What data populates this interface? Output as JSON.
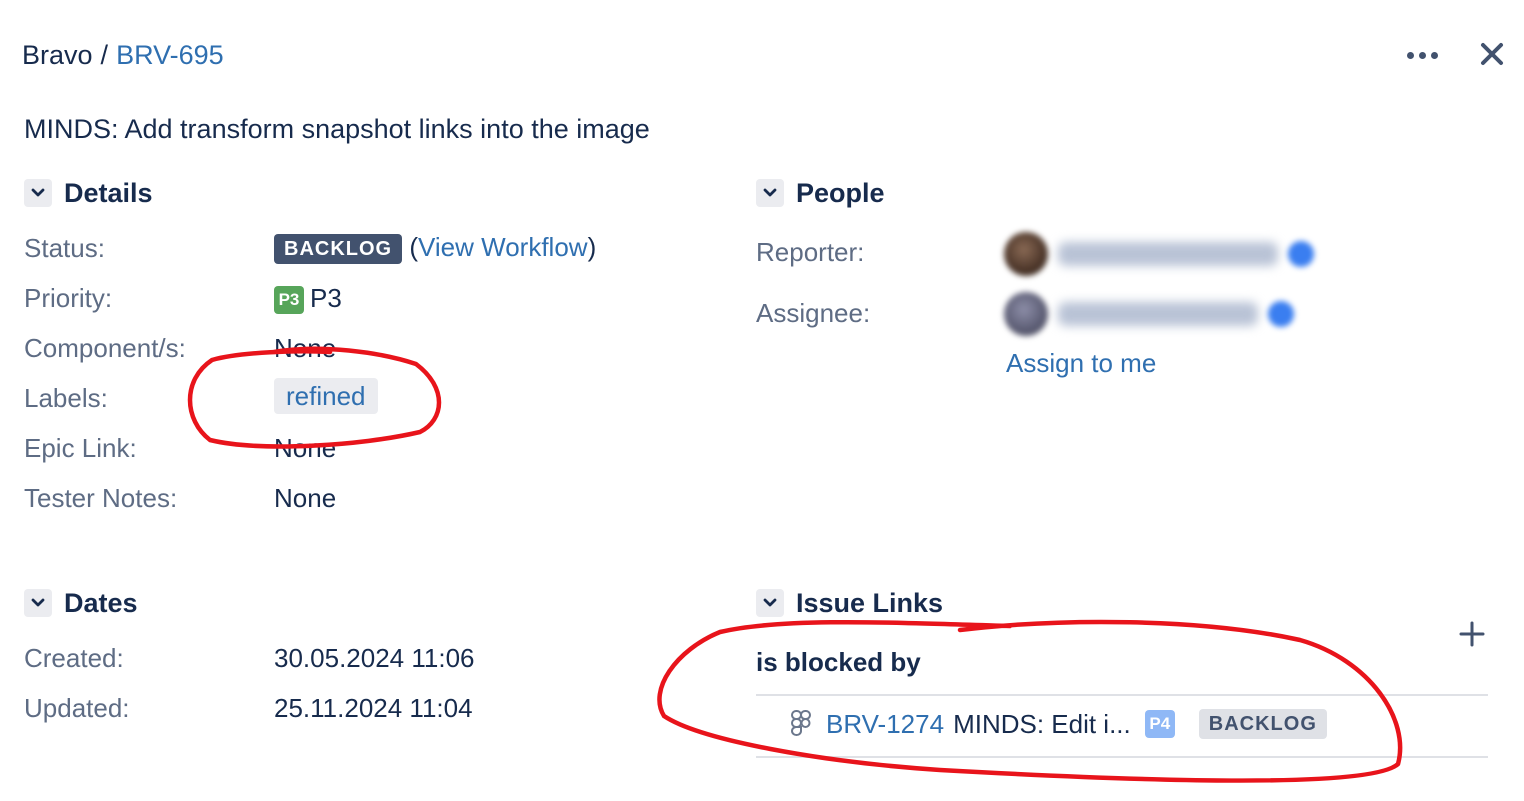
{
  "header": {
    "project": "Bravo",
    "separator": "/",
    "issue_key": "BRV-695",
    "more_icon": "more-horizontal-icon",
    "close_icon": "close-icon"
  },
  "summary": "MINDS: Add transform snapshot links into the image",
  "details": {
    "title": "Details",
    "status_label": "Status:",
    "status_value": "BACKLOG",
    "view_workflow_open": "(",
    "view_workflow": "View Workflow",
    "view_workflow_close": ")",
    "priority_label": "Priority:",
    "priority_badge": "P3",
    "priority_value": "P3",
    "components_label": "Component/s:",
    "components_value": "None",
    "labels_label": "Labels:",
    "labels_value": "refined",
    "epic_label": "Epic Link:",
    "epic_value": "None",
    "tester_label": "Tester Notes:",
    "tester_value": "None"
  },
  "people": {
    "title": "People",
    "reporter_label": "Reporter:",
    "assignee_label": "Assignee:",
    "assign_to_me": "Assign to me"
  },
  "dates": {
    "title": "Dates",
    "created_label": "Created:",
    "created_value": "30.05.2024 11:06",
    "updated_label": "Updated:",
    "updated_value": "25.11.2024 11:04"
  },
  "issue_links": {
    "title": "Issue Links",
    "add_icon": "plus-icon",
    "relation": "is blocked by",
    "items": [
      {
        "type_icon": "figma-icon",
        "key": "BRV-1274",
        "summary": "MINDS: Edit i...",
        "priority": "P4",
        "status": "BACKLOG"
      }
    ]
  },
  "colors": {
    "link": "#2f6fb0",
    "text": "#172b4d",
    "muted": "#5e6c84",
    "p3": "#57a55a",
    "p4": "#8fb8f6",
    "annotation": "#e8141b"
  }
}
